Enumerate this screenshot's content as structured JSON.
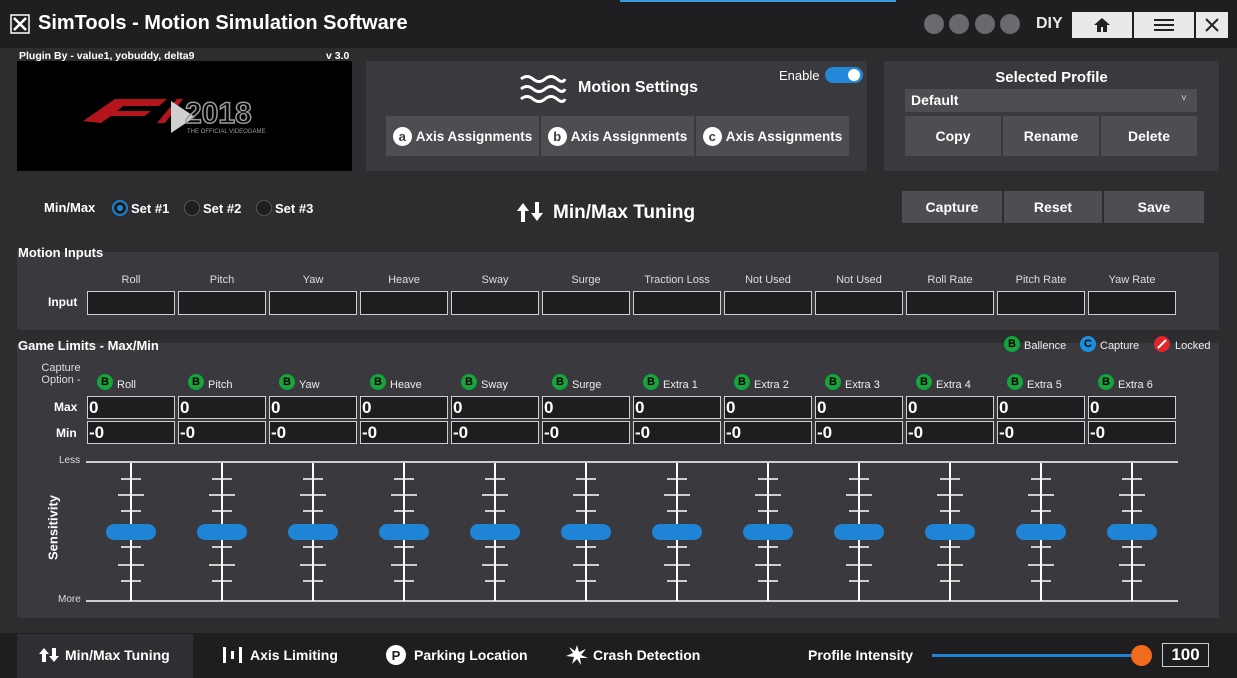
{
  "titlebar": {
    "app_name": "SimTools - Motion Simulation Software",
    "diy_label": "DIY"
  },
  "plugin": {
    "by": "Plugin By - value1, yobuddy, delta9",
    "version": "v 3.0",
    "game_logo_text": "F1 2018",
    "game_logo_subtitle": "THE OFFICIAL VIDEOGAME"
  },
  "motion_settings": {
    "title": "Motion Settings",
    "enable_label": "Enable",
    "enabled": true,
    "axis_buttons": [
      {
        "letter": "a",
        "label": "Axis Assignments"
      },
      {
        "letter": "b",
        "label": "Axis Assignments"
      },
      {
        "letter": "c",
        "label": "Axis Assignments"
      }
    ]
  },
  "profile": {
    "title": "Selected Profile",
    "selected": "Default",
    "buttons": [
      "Copy",
      "Rename",
      "Delete"
    ]
  },
  "minmax": {
    "label": "Min/Max",
    "sets": [
      "Set #1",
      "Set #2",
      "Set #3"
    ],
    "selected_set": 0,
    "title": "Min/Max Tuning",
    "actions": [
      "Capture",
      "Reset",
      "Save"
    ]
  },
  "motion_inputs": {
    "title": "Motion Inputs",
    "row_label": "Input",
    "columns": [
      "Roll",
      "Pitch",
      "Yaw",
      "Heave",
      "Sway",
      "Surge",
      "Traction Loss",
      "Not Used",
      "Not Used",
      "Roll Rate",
      "Pitch Rate",
      "Yaw Rate"
    ]
  },
  "game_limits": {
    "title": "Game Limits - Max/Min",
    "capture_option_label": "Capture Option -",
    "legend": [
      {
        "icon": "B",
        "label": "Ballence",
        "color": "#1fa13a"
      },
      {
        "icon": "C",
        "label": "Capture",
        "color": "#1a90dc"
      },
      {
        "icon": "locked",
        "label": "Locked",
        "color": "#e0262b"
      }
    ],
    "columns": [
      "Roll",
      "Pitch",
      "Yaw",
      "Heave",
      "Sway",
      "Surge",
      "Extra 1",
      "Extra 2",
      "Extra 3",
      "Extra 4",
      "Extra 5",
      "Extra 6"
    ],
    "max_label": "Max",
    "min_label": "Min",
    "max_values": [
      "0",
      "0",
      "0",
      "0",
      "0",
      "0",
      "0",
      "0",
      "0",
      "0",
      "0",
      "0"
    ],
    "min_values": [
      "-0",
      "-0",
      "-0",
      "-0",
      "-0",
      "-0",
      "-0",
      "-0",
      "-0",
      "-0",
      "-0",
      "-0"
    ],
    "sensitivity_label": "Sensitivity",
    "less_label": "Less",
    "more_label": "More",
    "sensitivity_level": 0.5
  },
  "bottom": {
    "tabs": [
      "Min/Max Tuning",
      "Axis Limiting",
      "Parking Location",
      "Crash Detection"
    ],
    "active_tab": 0,
    "intensity_label": "Profile Intensity",
    "intensity_value": "100"
  },
  "colors": {
    "accent": "#2084d6",
    "knob": "#f26a1b",
    "balance": "#1fa13a",
    "capture": "#1a90dc",
    "locked": "#e0262b"
  }
}
